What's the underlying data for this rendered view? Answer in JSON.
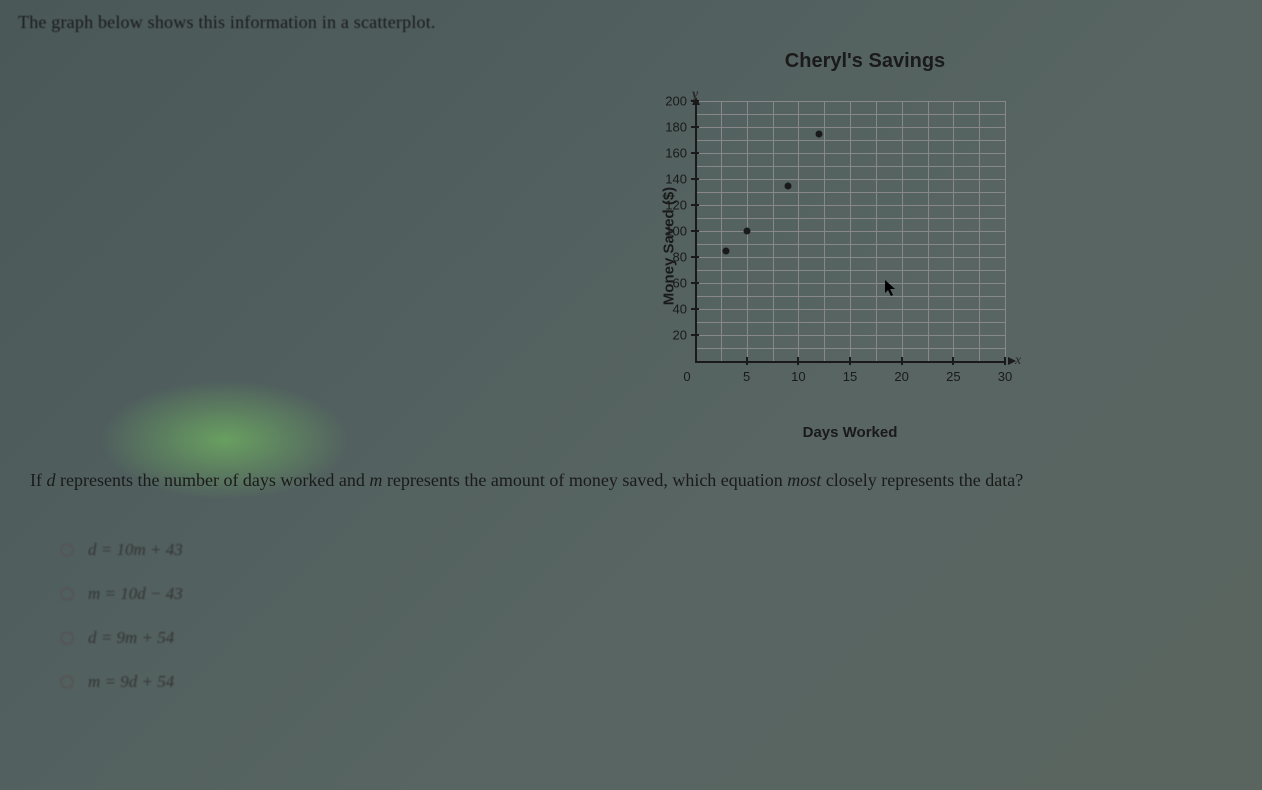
{
  "intro": "The graph below shows this information in a scatterplot.",
  "chart_data": {
    "type": "scatter",
    "title": "Cheryl's Savings",
    "xlabel": "Days Worked",
    "ylabel": "Money Saved ($)",
    "x_axis_var": "x",
    "y_axis_var": "y",
    "xlim": [
      0,
      30
    ],
    "ylim": [
      0,
      200
    ],
    "x_ticks": [
      0,
      5,
      10,
      15,
      20,
      25,
      30
    ],
    "y_ticks": [
      20,
      40,
      60,
      80,
      100,
      120,
      140,
      160,
      180,
      200
    ],
    "x_tick_labels": [
      "0",
      "5",
      "10",
      "15",
      "20",
      "25",
      "30"
    ],
    "y_tick_labels": [
      "20",
      "40",
      "60",
      "80",
      "100",
      "120",
      "140",
      "160",
      "180",
      "200"
    ],
    "origin_label": "0",
    "points": [
      {
        "x": 3,
        "y": 85
      },
      {
        "x": 5,
        "y": 100
      },
      {
        "x": 9,
        "y": 135
      },
      {
        "x": 12,
        "y": 175
      }
    ]
  },
  "question": {
    "prefix": "If ",
    "var_d": "d",
    "mid1": " represents the number of days worked and ",
    "var_m": "m",
    "mid2": " represents the amount of money saved, which equation ",
    "emphasis": "most",
    "suffix": " closely represents the data?"
  },
  "options": [
    {
      "label": "d = 10m + 43"
    },
    {
      "label": "m = 10d − 43"
    },
    {
      "label": "d = 9m + 54"
    },
    {
      "label": "m = 9d + 54"
    }
  ]
}
